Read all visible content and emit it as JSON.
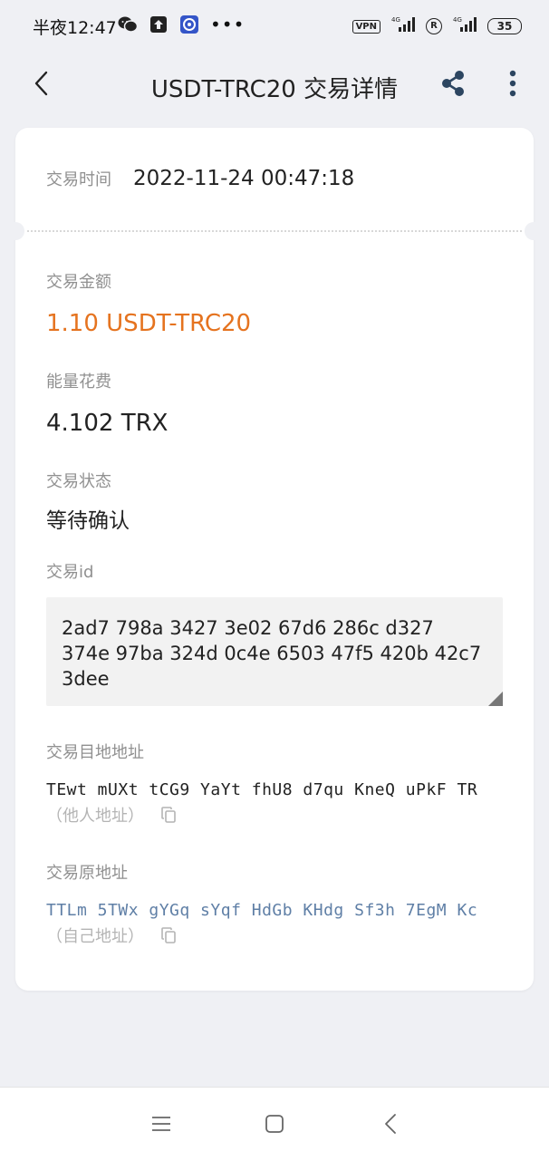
{
  "status_bar": {
    "time": "半夜12:47",
    "vpn": "VPN",
    "net1": "4G",
    "net2": "4G",
    "reg": "R",
    "battery": "35",
    "dots": "•••"
  },
  "header": {
    "title": "USDT-TRC20 交易详情"
  },
  "detail": {
    "time_label": "交易时间",
    "time_value": "2022-11-24 00:47:18",
    "amount_label": "交易金额",
    "amount_value": "1.10 USDT-TRC20",
    "energy_label": "能量花费",
    "energy_value": "4.102 TRX",
    "status_label": "交易状态",
    "status_value": "等待确认",
    "txid_label": "交易id",
    "txid_value": "2ad7 798a 3427 3e02 67d6 286c d327 374e 97ba 324d 0c4e 6503 47f5 420b 42c7 3dee",
    "to_label": "交易目地地址",
    "to_value": "TEwt mUXt tCG9 YaYt fhU8 d7qu KneQ uPkF TR",
    "to_note": "（他人地址）",
    "from_label": "交易原地址",
    "from_value": "TTLm 5TWx gYGq sYqf HdGb KHdg Sf3h 7EgM Kc",
    "from_note": "（自己地址）"
  },
  "colors": {
    "amount": "#e5731f",
    "own_address": "#5f7fa6",
    "label": "#909090",
    "background": "#eff0f4"
  },
  "icons": {
    "back": "chevron-left-icon",
    "share": "share-icon",
    "more": "more-vertical-icon",
    "copy": "copy-icon",
    "nav_menu": "menu-icon",
    "nav_home": "square-icon",
    "nav_back": "chevron-left-icon"
  }
}
